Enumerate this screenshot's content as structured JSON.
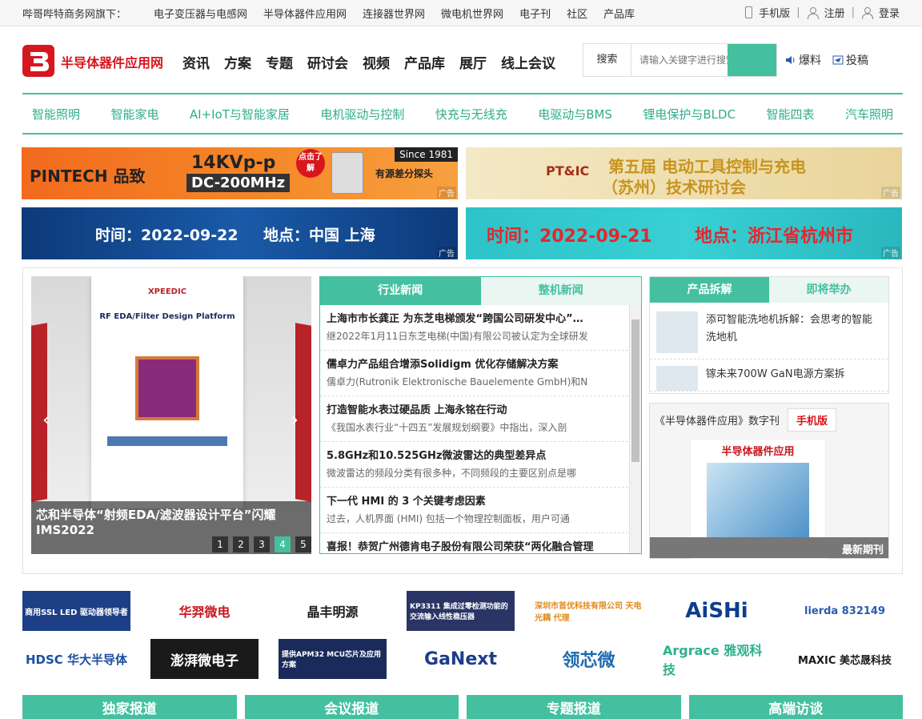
{
  "topbar": {
    "brand": "哔哥哔特商务网旗下：",
    "links": [
      "电子变压器与电感网",
      "半导体器件应用网",
      "连接器世界网",
      "微电机世界网",
      "电子刊",
      "社区",
      "产品库"
    ],
    "mobile": "手机版",
    "register": "注册",
    "login": "登录"
  },
  "header": {
    "site_name": "半导体器件应用网",
    "nav": [
      "资讯",
      "方案",
      "专题",
      "研讨会",
      "视频",
      "产品库",
      "展厅",
      "线上会议"
    ],
    "search_label": "搜索",
    "search_placeholder": "请输入关键字进行搜索",
    "links": [
      "爆料",
      "投稿"
    ]
  },
  "subnav": [
    "智能照明",
    "智能家电",
    "AI+IoT与智能家居",
    "电机驱动与控制",
    "快充与无线充",
    "电驱动与BMS",
    "锂电保护与BLDC",
    "智能四表",
    "汽车照明"
  ],
  "ads": {
    "ad_label": "广告",
    "pintech": {
      "brand": "PINTECH 品致",
      "spec1": "14KVp-p",
      "spec2": "DC-200MHz",
      "since": "Since 1981",
      "badge": "点击了解",
      "desc": "有源差分探头"
    },
    "ptic": {
      "logo": "PT&IC",
      "title1": "第五届 电动工具控制与充电",
      "title2": "（苏州）技术研讨会"
    },
    "shanghai": {
      "time": "时间：2022-09-22",
      "place": "地点：中国 上海"
    },
    "hangzhou": {
      "time": "时间：2022-09-21",
      "place": "地点：浙江省杭州市"
    }
  },
  "slider": {
    "slide_brand": "XPEEDIC",
    "slide_title": "RF EDA/Filter Design Platform",
    "caption": "芯和半导体“射频EDA/滤波器设计平台”闪耀IMS2022",
    "pages": [
      "1",
      "2",
      "3",
      "4",
      "5"
    ],
    "active_page": "4"
  },
  "news": {
    "tabs": [
      "行业新闻",
      "整机新闻"
    ],
    "items": [
      {
        "title": "上海市市长龚正 为东芝电梯颁发“跨国公司研发中心”…",
        "desc": "继2022年1月11日东芝电梯(中国)有限公司被认定为全球研发"
      },
      {
        "title": "儒卓力产品组合增添Solidigm 优化存储解决方案",
        "desc": "儒卓力(Rutronik Elektronische Bauelemente GmbH)和N"
      },
      {
        "title": "打造智能水表过硬品质 上海永铭在行动",
        "desc": "《我国水表行业“十四五”发展规划纲要》中指出，深入剖"
      },
      {
        "title": "5.8GHz和10.525GHz微波雷达的典型差异点",
        "desc": "微波雷达的频段分类有很多种，不同频段的主要区别点是哪"
      },
      {
        "title": "下一代 HMI 的 3 个关键考虑因素",
        "desc": "过去，人机界面 (HMI) 包括一个物理控制面板，用户可通"
      },
      {
        "title": "喜报！恭贺广州德肯电子股份有限公司荣获“两化融合管理",
        "desc": ""
      }
    ]
  },
  "products": {
    "tabs": [
      "产品拆解",
      "即将举办"
    ],
    "items": [
      "添可智能洗地机拆解：会思考的智能洗地机",
      "镓未来700W GaN电源方案拆"
    ]
  },
  "magazine": {
    "title": "《半导体器件应用》数字刊",
    "mobile_btn": "手机版",
    "cover_title": "半导体器件应用",
    "footer": "最新期刊"
  },
  "logos": [
    {
      "name": "商用SSL LED 驱动器领导者",
      "color": "#ffffff",
      "bg": "#1c3f86"
    },
    {
      "name": "华羿微电",
      "color": "#c8161d",
      "bg": "#ffffff"
    },
    {
      "name": "晶丰明源",
      "color": "#1a1a1a",
      "bg": "#ffffff"
    },
    {
      "name": "KP3311 集成过零检测功能的交流输入线性稳压器",
      "color": "#ffffff",
      "bg": "#2a3566"
    },
    {
      "name": "深圳市首优科技有限公司 天电光耦 代理",
      "color": "#e08a1a",
      "bg": "#ffffff"
    },
    {
      "name": "AiSHi",
      "color": "#0d3d8c",
      "bg": "#ffffff"
    },
    {
      "name": "lierda 832149",
      "color": "#2a5bb0",
      "bg": "#ffffff"
    },
    {
      "name": "HDSC 华大半导体",
      "color": "#1d4fa0",
      "bg": "#ffffff"
    },
    {
      "name": "澎湃微电子",
      "color": "#ffffff",
      "bg": "#1a1a1a"
    },
    {
      "name": "提供APM32 MCU芯片及应用方案",
      "color": "#ffffff",
      "bg": "#1a2a5a"
    },
    {
      "name": "GaNext",
      "color": "#1d3c8c",
      "bg": "#ffffff"
    },
    {
      "name": "领芯微",
      "color": "#1d6ab0",
      "bg": "#ffffff"
    },
    {
      "name": "Argrace 雅观科技",
      "color": "#2eb08c",
      "bg": "#ffffff"
    },
    {
      "name": "MAXIC 美芯晟科技",
      "color": "#1a1a1a",
      "bg": "#ffffff"
    }
  ],
  "bottom_tabs": [
    "独家报道",
    "会议报道",
    "专题报道",
    "高端访谈"
  ],
  "colors": {
    "accent": "#44c0a0",
    "brand_red": "#d7161e"
  }
}
